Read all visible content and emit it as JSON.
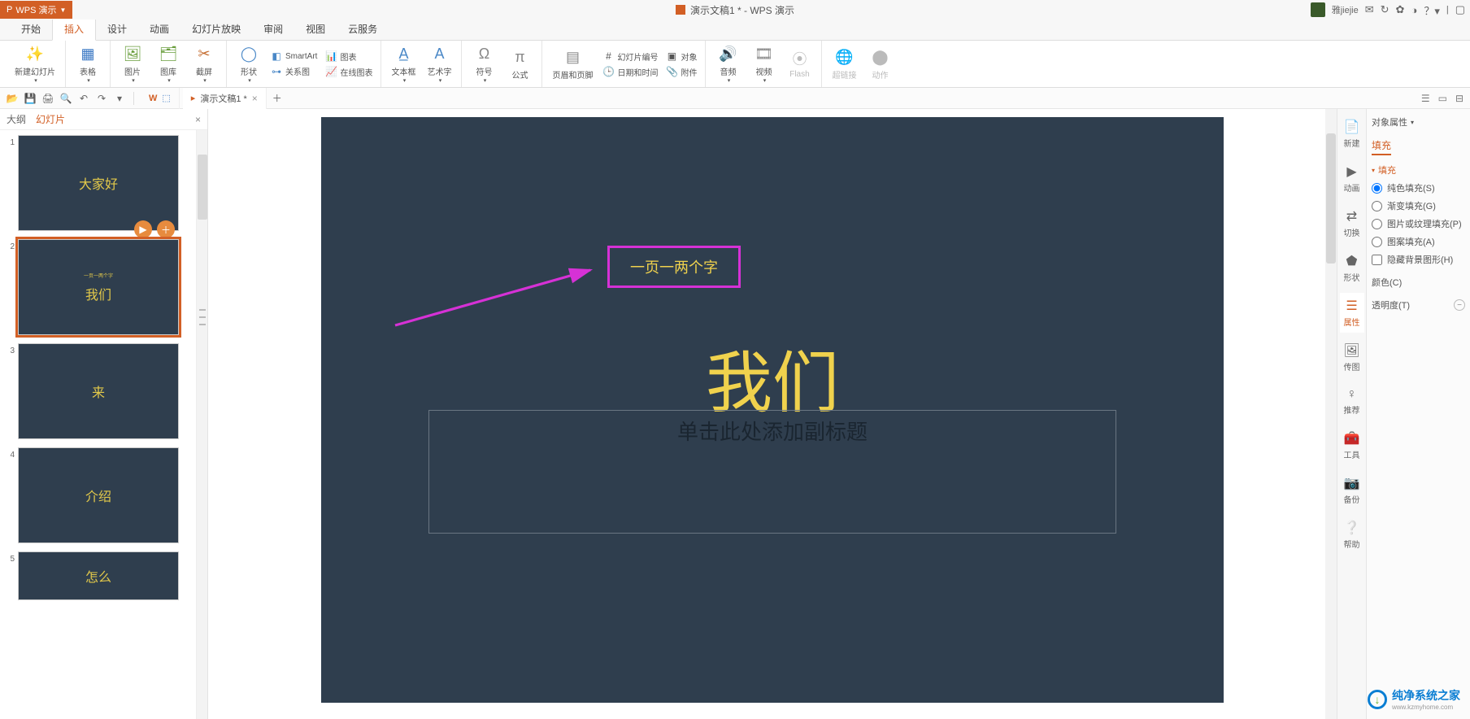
{
  "app": {
    "name": "WPS 演示",
    "window_title": "演示文稿1 * - WPS 演示",
    "user": "雅jiejie"
  },
  "menu": {
    "tabs": [
      "开始",
      "插入",
      "设计",
      "动画",
      "幻灯片放映",
      "审阅",
      "视图",
      "云服务"
    ],
    "active_index": 1
  },
  "ribbon": {
    "new_slide": "新建幻灯片",
    "table": "表格",
    "picture": "图片",
    "gallery": "图库",
    "screenshot": "截屏",
    "shapes": "形状",
    "smartart": "SmartArt",
    "chart": "图表",
    "relation": "关系图",
    "online_chart": "在线图表",
    "textbox": "文本框",
    "wordart": "艺术字",
    "symbol": "符号",
    "equation": "公式",
    "header_footer": "页眉和页脚",
    "slide_number": "幻灯片编号",
    "datetime": "日期和时间",
    "object": "对象",
    "attachment": "附件",
    "audio": "音频",
    "video": "视频",
    "flash": "Flash",
    "hyperlink": "超链接",
    "action": "动作"
  },
  "doc_tab": {
    "name": "演示文稿1 *"
  },
  "left": {
    "tab_outline": "大纲",
    "tab_slides": "幻灯片",
    "slides": [
      {
        "num": "1",
        "title": "大家好"
      },
      {
        "num": "2",
        "title": "我们",
        "tiny": "一页一两个字"
      },
      {
        "num": "3",
        "title": "来"
      },
      {
        "num": "4",
        "title": "介绍"
      },
      {
        "num": "5",
        "title": "怎么"
      }
    ]
  },
  "slide": {
    "annotation": "一页一两个字",
    "title": "我们",
    "subtitle_placeholder": "单击此处添加副标题"
  },
  "right_sidebar": {
    "items": [
      "新建",
      "动画",
      "切换",
      "形状",
      "属性",
      "传图",
      "推荐",
      "工具",
      "备份",
      "帮助"
    ],
    "active_index": 4
  },
  "props": {
    "panel_title": "对象属性",
    "tab_fill": "填充",
    "section_fill": "填充",
    "opt_solid": "纯色填充(S)",
    "opt_gradient": "渐变填充(G)",
    "opt_picture": "图片或纹理填充(P)",
    "opt_pattern": "图案填充(A)",
    "opt_hidebg": "隐藏背景图形(H)",
    "color_label": "颜色(C)",
    "opacity_label": "透明度(T)"
  },
  "watermark": {
    "text": "纯净系统之家",
    "sub": "www.kzmyhome.com"
  }
}
